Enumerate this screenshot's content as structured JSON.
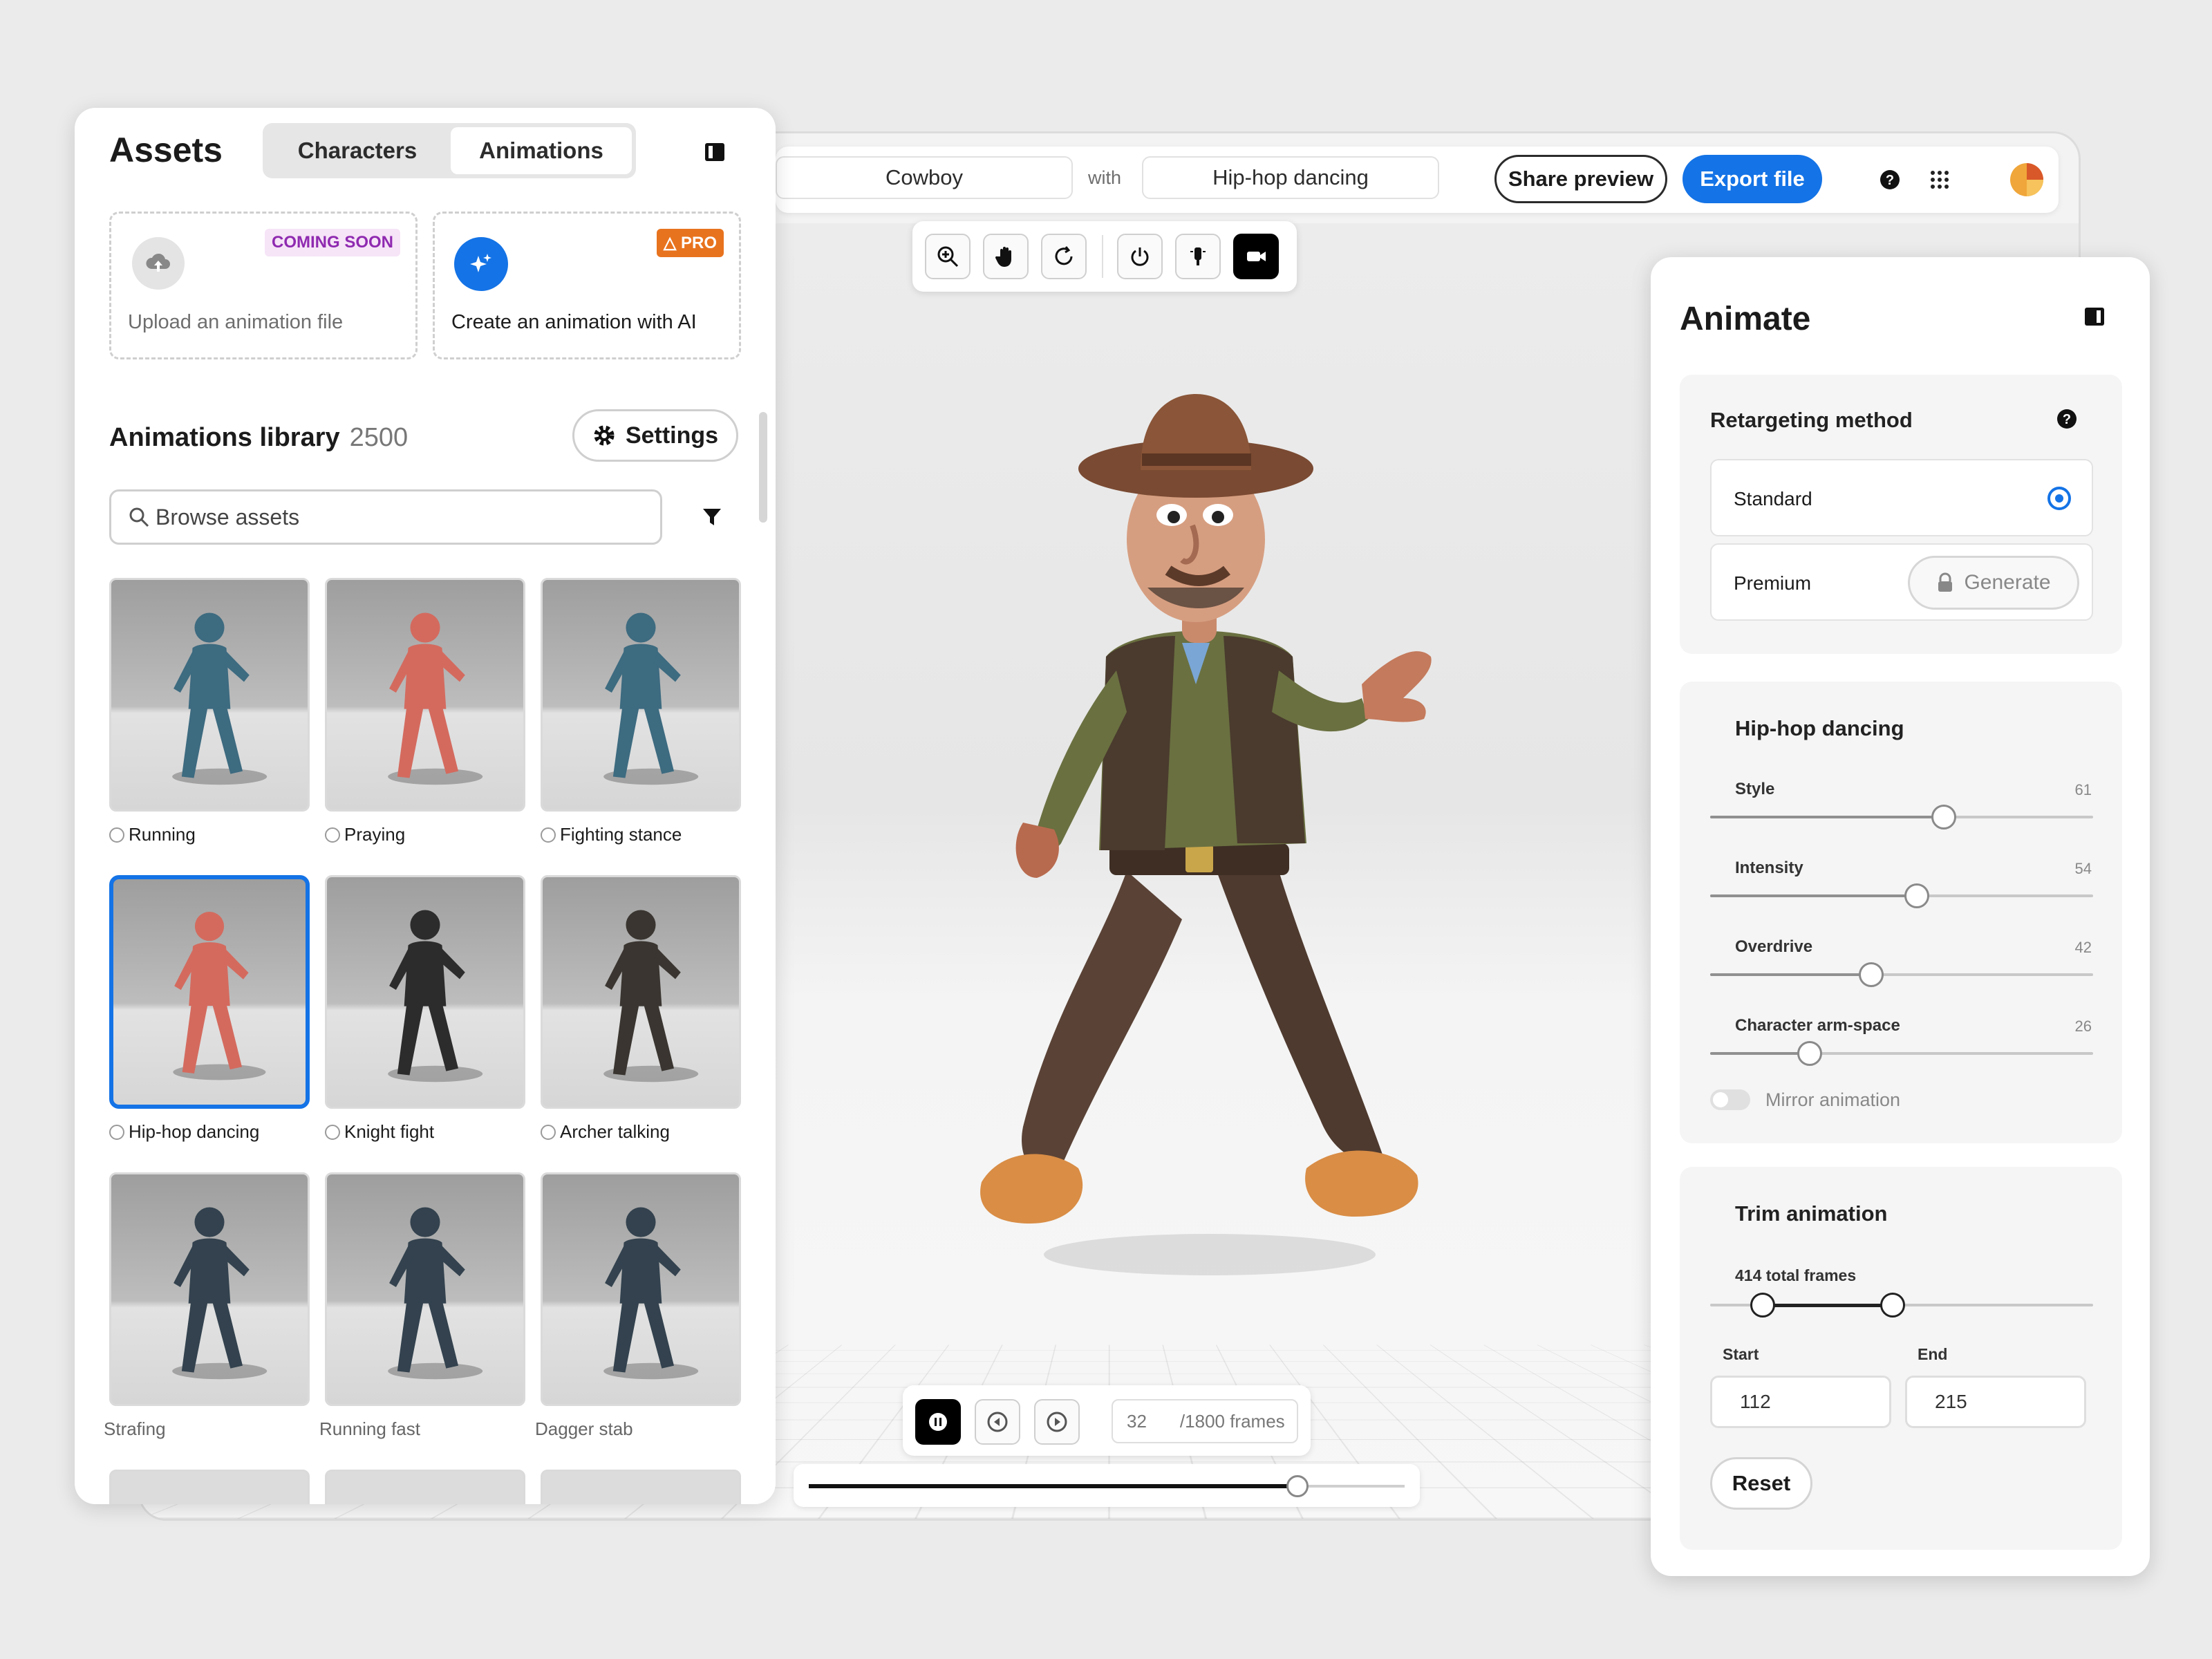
{
  "colors": {
    "accent": "#1473e6",
    "pro": "#e8731e",
    "coming_soon_bg": "#f6e4f7",
    "coming_soon_text": "#8f2ab0"
  },
  "topbar": {
    "character": "Cowboy",
    "with_label": "with",
    "animation": "Hip-hop dancing",
    "share_label": "Share preview",
    "export_label": "Export file",
    "help_icon": "help-icon",
    "apps_icon": "apps-grid-icon",
    "avatar_icon": "avatar-icon"
  },
  "viewport_toolbar": {
    "tools": [
      "zoom-in-icon",
      "hand-pan-icon",
      "rotate-icon",
      "power-icon",
      "light-icon",
      "camera-icon"
    ]
  },
  "assets": {
    "title": "Assets",
    "tabs": [
      {
        "label": "Characters",
        "active": false
      },
      {
        "label": "Animations",
        "active": true
      }
    ],
    "panel_icon": "panel-toggle-icon",
    "upload": {
      "title": "Upload an animation file",
      "badge": "COMING SOON"
    },
    "ai": {
      "title": "Create an animation with AI",
      "badge": "PRO"
    },
    "library": {
      "title": "Animations library",
      "count": "2500",
      "settings_label": "Settings"
    },
    "search_placeholder": "Browse assets",
    "items": [
      {
        "label": "Running",
        "model": "blue-figure",
        "selected": false
      },
      {
        "label": "Praying",
        "model": "red-figure",
        "selected": false
      },
      {
        "label": "Fighting stance",
        "model": "blue-figure",
        "selected": false
      },
      {
        "label": "Hip-hop dancing",
        "model": "red-figure",
        "selected": true
      },
      {
        "label": "Knight fight",
        "model": "knight",
        "selected": false
      },
      {
        "label": "Archer talking",
        "model": "archer",
        "selected": false
      },
      {
        "label": "Strafing",
        "model": "soldier",
        "selected": false
      },
      {
        "label": "Running fast",
        "model": "soldier",
        "selected": false
      },
      {
        "label": "Dagger stab",
        "model": "soldier",
        "selected": false
      }
    ]
  },
  "animate": {
    "title": "Animate",
    "panel_icon": "panel-toggle-icon",
    "retarget": {
      "title": "Retargeting method",
      "options": [
        {
          "label": "Standard",
          "selected": true
        },
        {
          "label": "Premium",
          "selected": false
        }
      ],
      "generate_label": "Generate"
    },
    "dance": {
      "title": "Hip-hop dancing",
      "sliders": [
        {
          "label": "Style",
          "value": 61
        },
        {
          "label": "Intensity",
          "value": 54
        },
        {
          "label": "Overdrive",
          "value": 42
        },
        {
          "label": "Character arm-space",
          "value": 26
        }
      ],
      "mirror_label": "Mirror animation",
      "mirror_on": false
    },
    "trim": {
      "title": "Trim animation",
      "total_label": "414 total frames",
      "start_label": "Start",
      "end_label": "End",
      "start": "112",
      "end": "215",
      "reset_label": "Reset"
    }
  },
  "playback": {
    "current_frame": "32",
    "total_frames": "/1800 frames",
    "progress": 0.82
  }
}
